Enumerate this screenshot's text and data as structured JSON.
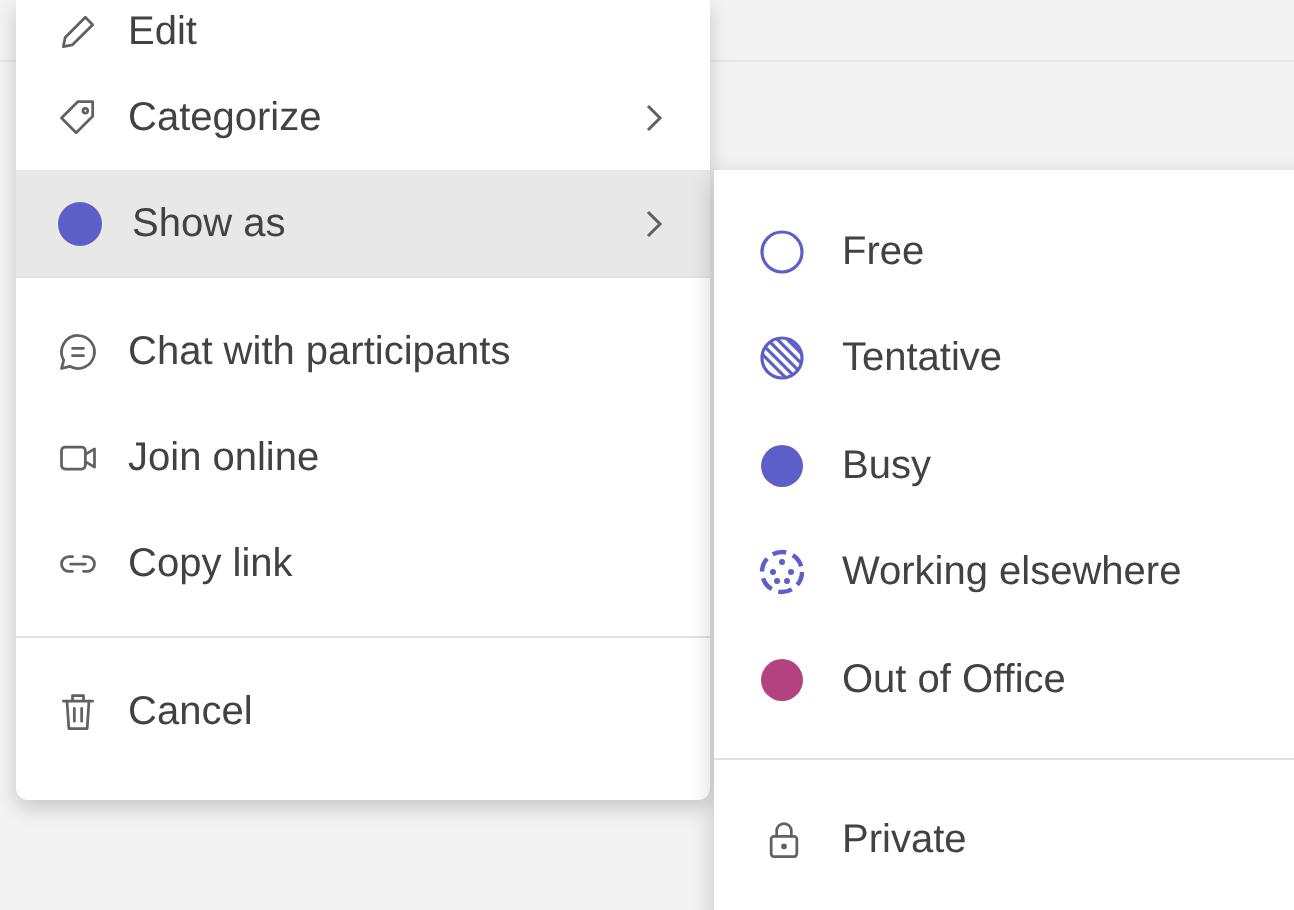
{
  "menu": {
    "sections": [
      {
        "items": [
          {
            "label": "Edit",
            "selected": false,
            "submenu": false
          },
          {
            "label": "Categorize",
            "selected": false,
            "submenu": true
          },
          {
            "label": "Show as",
            "selected": true,
            "submenu": true,
            "color": "#5b5fc7"
          }
        ]
      },
      {
        "items": [
          {
            "label": "Chat with participants",
            "selected": false,
            "submenu": false
          },
          {
            "label": "Join online",
            "selected": false,
            "submenu": false
          },
          {
            "label": "Copy link",
            "selected": false,
            "submenu": false
          }
        ]
      },
      {
        "items": [
          {
            "label": "Cancel",
            "selected": false,
            "submenu": false
          }
        ]
      }
    ]
  },
  "submenu": {
    "statuses": [
      {
        "label": "Free",
        "kind": "hollow",
        "color": "#5b5fc7"
      },
      {
        "label": "Tentative",
        "kind": "striped",
        "color": "#5b5fc7"
      },
      {
        "label": "Busy",
        "kind": "solid",
        "color": "#5b5fc7"
      },
      {
        "label": "Working elsewhere",
        "kind": "dotted",
        "color": "#5b5fc7"
      },
      {
        "label": "Out of Office",
        "kind": "solid",
        "color": "#b4427f"
      }
    ],
    "private": {
      "label": "Private"
    }
  }
}
